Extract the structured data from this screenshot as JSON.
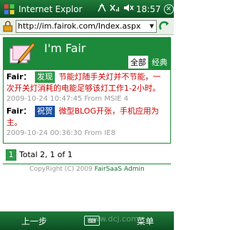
{
  "status": {
    "title": "Internet Explor",
    "time": "18:57"
  },
  "address": {
    "url": "http://im.fairok.com/Index.aspx"
  },
  "header": {
    "site_name": "I'm Fair",
    "tabs": [
      "全部",
      "经典"
    ]
  },
  "posts": [
    {
      "author": "Fair：",
      "tag": "发现",
      "text": "节能灯随手关灯并不节能，一次开关灯消耗的电能足够该灯工作1-2小时。",
      "meta": "2009-10-24 10:47:45 From MSIE 4"
    },
    {
      "author": "Fair：",
      "tag": "祝贺",
      "text": "微型BLOG开张，手机应用为主。",
      "meta": "2009-10-24 00:36:30 From IE8"
    }
  ],
  "pager": {
    "current_page": "1",
    "total": "Total 2, 1 of 1"
  },
  "footer": {
    "copyright": "CopyRight (C) 2009 ",
    "link": "FairSaaS Admin"
  },
  "softkeys": {
    "left": "上一步",
    "right": "菜单"
  },
  "watermark": "www.dcj.com"
}
